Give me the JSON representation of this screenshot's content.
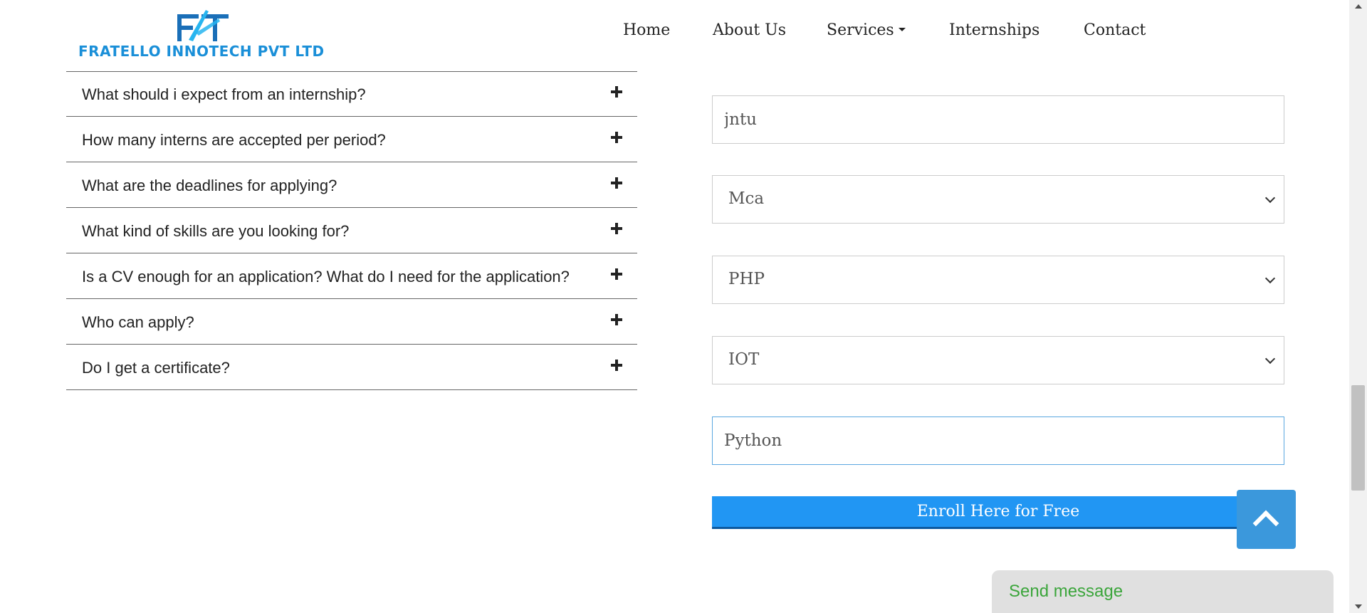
{
  "brand": {
    "name": "FRATELLO INNOTECH PVT LTD",
    "colors": {
      "logo_blue": "#1a8fd8",
      "accent": "#2196f3",
      "send_green": "#3ba53b"
    }
  },
  "nav": {
    "items": [
      {
        "label": "Home"
      },
      {
        "label": "About Us"
      },
      {
        "label": "Services",
        "dropdown": true
      },
      {
        "label": "Internships"
      },
      {
        "label": "Contact"
      }
    ]
  },
  "faq": {
    "items": [
      {
        "question": "What should i expect from an internship?",
        "expanded": false
      },
      {
        "question": "How many interns are accepted per period?",
        "expanded": false
      },
      {
        "question": "What are the deadlines for applying?",
        "expanded": false
      },
      {
        "question": "What kind of skills are you looking for?",
        "expanded": false
      },
      {
        "question": "Is a CV enough for an application? What do I need for the application?",
        "expanded": false
      },
      {
        "question": "Who can apply?",
        "expanded": false
      },
      {
        "question": "Do I get a certificate?",
        "expanded": false
      }
    ]
  },
  "form": {
    "university": {
      "value": "jntu"
    },
    "course": {
      "selected": "Mca"
    },
    "technology": {
      "selected": "PHP"
    },
    "domain": {
      "selected": "IOT"
    },
    "skills": {
      "value": "Python"
    },
    "submit_label": "Enroll Here for Free"
  },
  "widgets": {
    "back_to_top_icon": "chevron-up-icon",
    "send_message_label": "Send message"
  }
}
